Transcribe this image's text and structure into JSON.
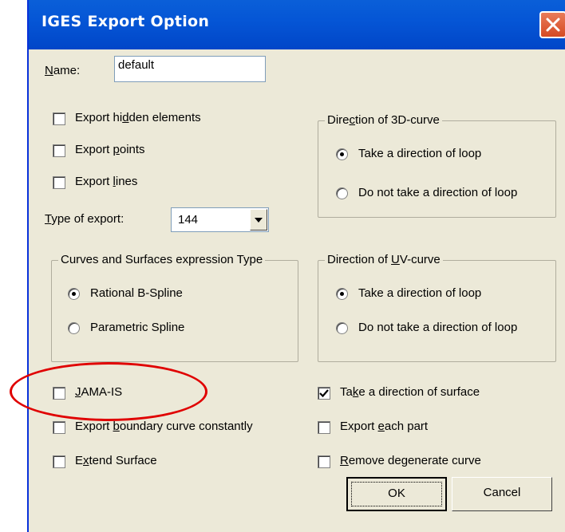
{
  "window": {
    "title": "IGES Export Option",
    "close_icon": "close-icon"
  },
  "name": {
    "label": "Name:",
    "value": "default"
  },
  "options": {
    "export_hidden": {
      "label": "Export hidden elements",
      "checked": false
    },
    "export_points": {
      "label": "Export points",
      "checked": false
    },
    "export_lines": {
      "label": "Export lines",
      "checked": false
    },
    "jama_is": {
      "label": "JAMA-IS",
      "checked": false
    },
    "export_boundary": {
      "label": "Export boundary curve constantly",
      "checked": false
    },
    "extend_surface": {
      "label": "Extend Surface",
      "checked": false
    },
    "take_surface_direction": {
      "label": "Take a direction of surface",
      "checked": true
    },
    "export_each_part": {
      "label": "Export each part",
      "checked": false
    },
    "remove_degenerate": {
      "label": "Remove degenerate curve",
      "checked": false
    }
  },
  "type_of_export": {
    "label": "Type of export:",
    "value": "144"
  },
  "curves_surfaces": {
    "title": "Curves and Surfaces expression Type",
    "options": [
      "Rational B-Spline",
      "Parametric Spline"
    ],
    "selected": 0
  },
  "direction_3d": {
    "title": "Direction of 3D-curve",
    "options": [
      "Take a direction of loop",
      "Do not take a direction of loop"
    ],
    "selected": 0
  },
  "direction_uv": {
    "title": "Direction of UV-curve",
    "options": [
      "Take a direction of loop",
      "Do not take a direction of loop"
    ],
    "selected": 0
  },
  "buttons": {
    "ok": "OK",
    "cancel": "Cancel"
  },
  "colors": {
    "titlebar": "#0556d6",
    "dialog_bg": "#ece9d8",
    "highlight_ellipse": "#e00000"
  }
}
